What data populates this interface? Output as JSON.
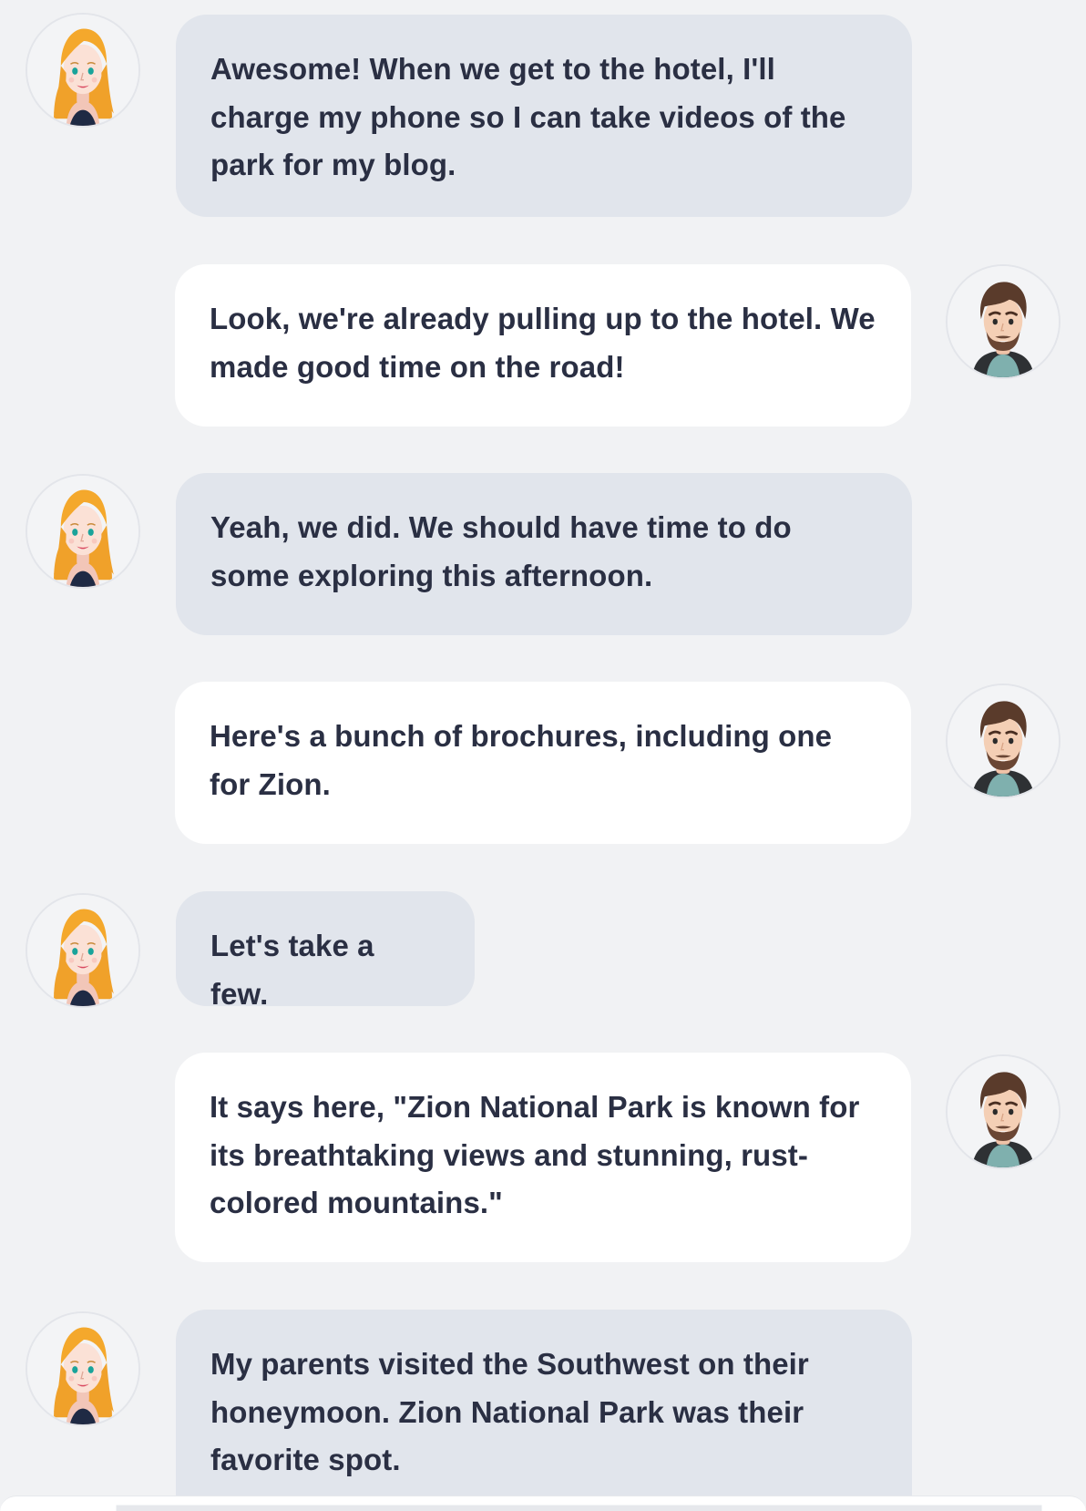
{
  "conversation": {
    "messages": [
      {
        "speaker": "woman",
        "text": "Awesome! When we get to the hotel, I'll charge my phone so I can take videos of the park for my blog."
      },
      {
        "speaker": "man",
        "text": "Look, we're already pulling up to the hotel. We made good time on the road!"
      },
      {
        "speaker": "woman",
        "text": "Yeah, we did. We should have time to do some exploring this afternoon."
      },
      {
        "speaker": "man",
        "text": "Here's a bunch of brochures, including one for Zion."
      },
      {
        "speaker": "woman",
        "text": "Let's take a few."
      },
      {
        "speaker": "man",
        "text": "It says here, \"Zion National Park is known for its breathtaking views and stunning, rust-colored mountains.\""
      },
      {
        "speaker": "woman",
        "text": "My parents visited the Southwest on their honeymoon. Zion National Park was their favorite spot."
      }
    ]
  },
  "icons": {
    "woman_avatar": "woman-avatar-icon",
    "man_avatar": "man-avatar-icon"
  },
  "colors": {
    "background": "#f1f2f4",
    "woman_bubble": "#e1e5ec",
    "man_bubble": "#ffffff",
    "text": "#2a2f43"
  }
}
